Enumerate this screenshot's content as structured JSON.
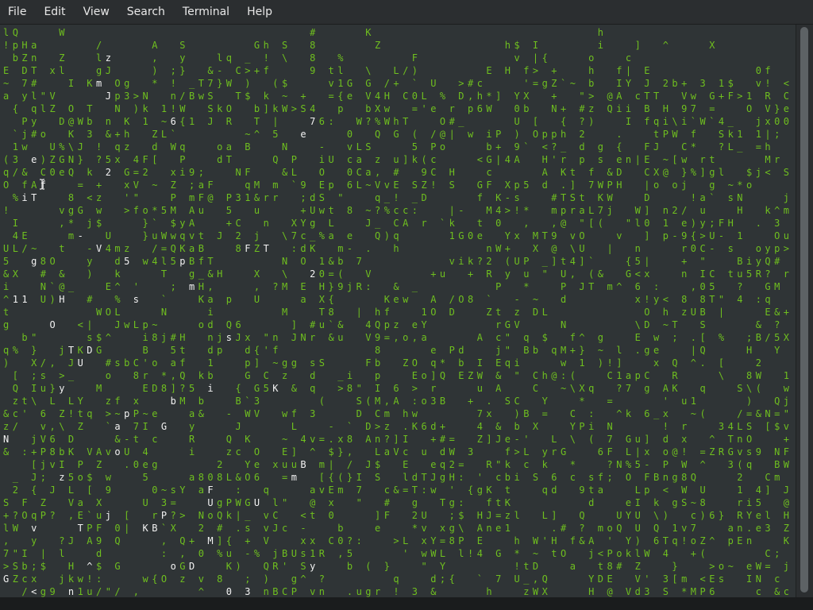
{
  "menu": [
    "File",
    "Edit",
    "View",
    "Search",
    "Terminal",
    "Help"
  ],
  "colors": {
    "background": "#2f3436",
    "menubar": "#2b2e30",
    "green": "#6fbf1f",
    "white": "#f2f2f2"
  },
  "icons": {
    "cursor": "text-cursor-icon"
  },
  "matrix": {
    "charset": "ABCDEFGHIJKLMNOPQRSTUVWXYZabcdefghijklmnopqrstuvwxyz0123456789!@#$%^&*()[]{}<>;:'\"/\\|_-+=~`?.,",
    "white_glyphs": [
      "N",
      "G",
      "1",
      "i",
      "1",
      "e",
      "T",
      "g",
      "v",
      "<",
      "f",
      "O",
      "H",
      "y",
      "z",
      "T",
      "n",
      "-",
      "U",
      "T",
      "D",
      "^",
      "m",
      "V",
      "z",
      "J",
      "2",
      "j",
      "a",
      "o",
      "5",
      "p",
      "s",
      "K",
      "B",
      "G",
      "P",
      "6",
      "b",
      "o",
      "p",
      "m",
      "D",
      "i",
      "F",
      "U",
      "M",
      "s",
      "0",
      "F",
      "3",
      "U",
      "T",
      "K",
      "m",
      "e",
      "B",
      "7",
      "2",
      "y"
    ],
    "seed": 1337
  }
}
